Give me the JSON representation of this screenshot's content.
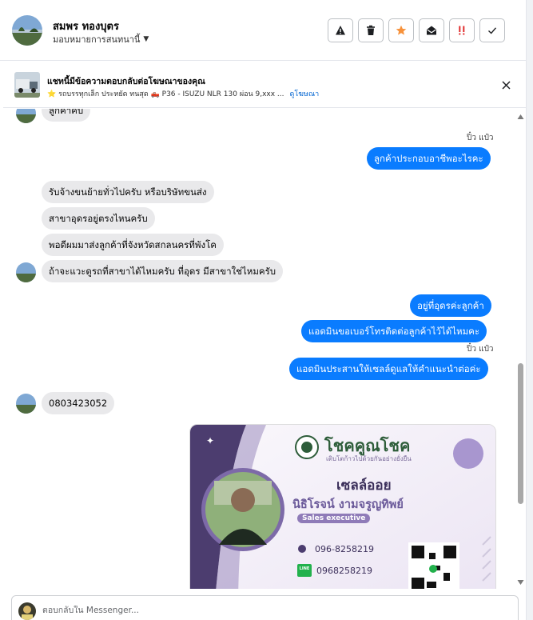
{
  "header": {
    "contact_name": "สมพร ทองบุตร",
    "assign_label": "มอบหมายการสนทนานี้",
    "actions": [
      {
        "icon": "warning-icon"
      },
      {
        "icon": "trash-icon"
      },
      {
        "icon": "star-icon"
      },
      {
        "icon": "mark-unread-icon"
      },
      {
        "icon": "priority-icon"
      },
      {
        "icon": "check-icon"
      }
    ]
  },
  "banner": {
    "title": "แชทนี้มีข้อความตอบกลับต่อโฆษณาของคุณ",
    "ad_text": "⭐ รถบรรทุกเล็ก ประหยัด ทนสุด 🛻 P36 - ISUZU NLR 130 ผ่อน 9,xxx ...",
    "ad_link": "ดูโฆษณา"
  },
  "messages": {
    "m0": "ลูกค้าคับ",
    "read1": "ปิ๋ว แป๋ว",
    "m1": "ลูกค้าประกอบอาชีพอะไรคะ",
    "m2": "รับจ้างขนย้ายทั่วไปครับ หรือบริษัทขนส่ง",
    "m3": "สาขาอุดรอยู่ตรงไหนครับ",
    "m4": "พอดีผมมาส่งลูกค้าที่จังหวัดสกลนครที่พังโค",
    "m5": "ถ้าจะแวะดูรถที่สาขาได้ไหมครับ ที่อุดร มีสาขาใช่ไหมครับ",
    "m6": "อยู่ที่อุดรค่ะลูกค้า",
    "m7": "แอดมินขอเบอร์โทรติดต่อลูกค้าไว้ได้ไหมคะ",
    "read2": "ปิ๋ว แป๋ว",
    "m8": "แอดมินประสานให้เซลล์ดูแลให้คำแนะนำต่อค่ะ",
    "m9": "0803423052"
  },
  "card": {
    "brand": "โชคคูณโชค",
    "tagline": "เติบโตก้าวไปด้วยกันอย่างยั่งยืน",
    "nickname": "เซลล์ออย",
    "fullname": "นิธิโรจน์  งามจรูญทิพย์",
    "role": "Sales executive",
    "phone": "096-8258219",
    "line": "0968258219",
    "line_badge": "LINE"
  },
  "composer": {
    "placeholder": "ตอบกลับใน Messenger..."
  },
  "colors": {
    "outgoing": "#0a7cff",
    "incoming": "#e9e9eb",
    "card_purple": "#6b5a9a",
    "card_green": "#2e5d3a"
  }
}
